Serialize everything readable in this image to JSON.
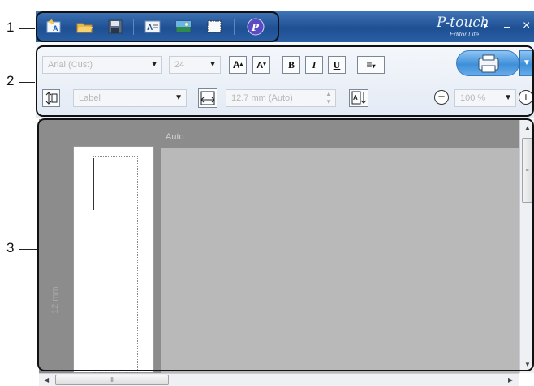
{
  "callouts": [
    "1",
    "2",
    "3"
  ],
  "titlebar": {
    "brand_name": "P-touch",
    "brand_sub": "Editor Lite",
    "buttons": {
      "dropdown": "▾",
      "minimize": "–",
      "close": "×"
    },
    "icons": [
      "new-label-icon",
      "open-folder-icon",
      "save-disk-icon",
      "text-icon",
      "image-icon",
      "frame-icon",
      "p-touch-logo-icon"
    ]
  },
  "toolbar": {
    "font_name": "Arial (Cust)",
    "font_size": "24",
    "increase_font_label": "A",
    "decrease_font_label": "A",
    "bold_label": "B",
    "italic_label": "I",
    "underline_label": "U",
    "align_label": "≡",
    "vertical_text_label": "Tt",
    "label_width": "Label",
    "tape_length": "12.7 mm (Auto)",
    "zoom_value": "100 %",
    "zoom_out_label": "−",
    "zoom_in_label": "+"
  },
  "workspace": {
    "ghost_text": "Auto",
    "vertical_ghost": "12 mm",
    "scroll_thumb_label": "III"
  },
  "colors": {
    "titlebar": "#1e4f93",
    "print_button": "#3e8fd9",
    "workspace_dark": "#8c8c8c",
    "workspace_light": "#b9b9b9"
  }
}
